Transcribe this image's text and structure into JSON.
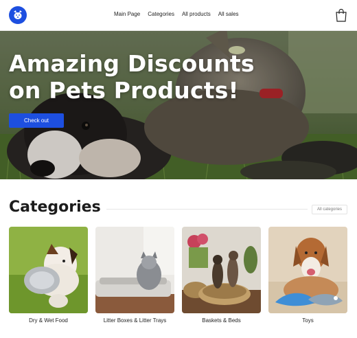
{
  "header": {
    "logo_icon": "dog-face-logo-icon",
    "nav": [
      {
        "label": "Main Page"
      },
      {
        "label": "Categories"
      },
      {
        "label": "All products"
      },
      {
        "label": "All sales"
      }
    ],
    "cart_icon": "shopping-bag-icon"
  },
  "hero": {
    "title_line1": "Amazing Discounts",
    "title_line2": "on Pets Products!",
    "cta_label": "Check out"
  },
  "categories": {
    "title": "Categories",
    "all_label": "All categories",
    "items": [
      {
        "label": "Dry & Wet Food"
      },
      {
        "label": "Litter Boxes & Litter Trays"
      },
      {
        "label": "Baskets & Beds"
      },
      {
        "label": "Toys"
      }
    ]
  },
  "colors": {
    "accent": "#1d4fe0",
    "text": "#1f1f1f"
  }
}
